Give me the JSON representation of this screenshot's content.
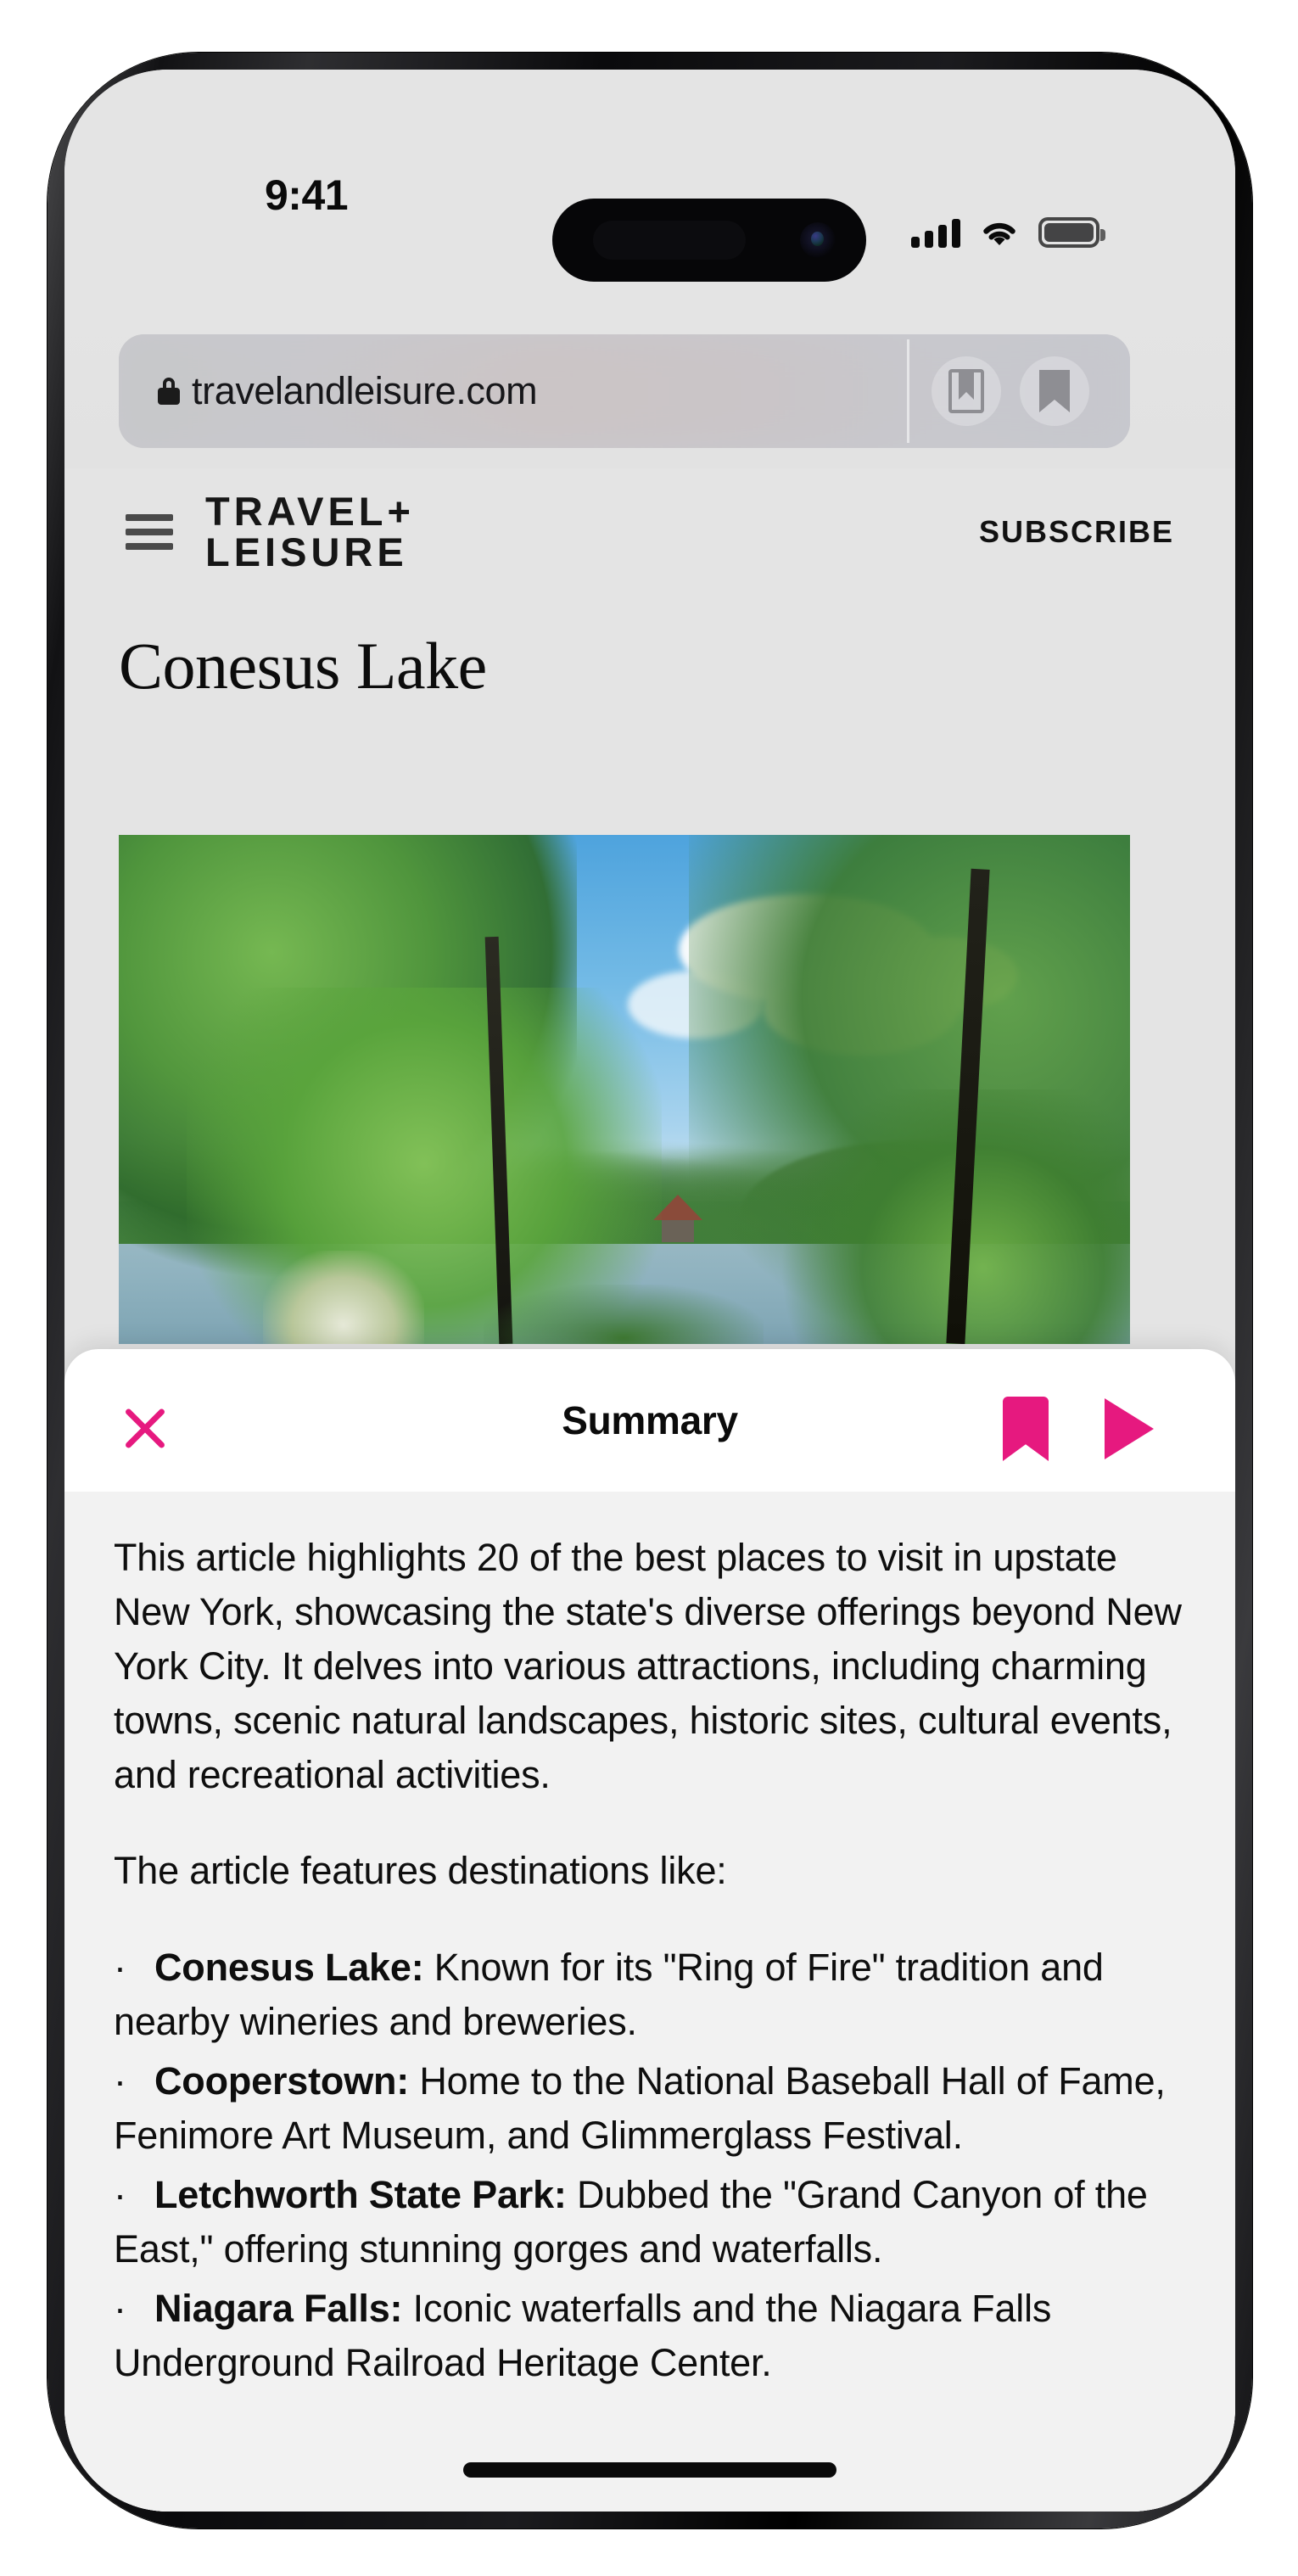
{
  "status_bar": {
    "time": "9:41",
    "cellular_icon": "cellular-signal-icon",
    "wifi_icon": "wifi-icon",
    "battery_icon": "battery-icon"
  },
  "browser": {
    "url": "travelandleisure.com",
    "lock_icon": "lock-icon",
    "reader_icon": "reader-view-icon",
    "bookmarks_icon": "bookmarks-icon"
  },
  "site_header": {
    "menu_icon": "hamburger-menu-icon",
    "brand_line1": "TRAVEL+",
    "brand_line2": "LEISURE",
    "subscribe_label": "SUBSCRIBE"
  },
  "article": {
    "headline": "Conesus Lake",
    "hero_image_alt": "Conesus Lake seen through green trees with a gazebo on the far shore"
  },
  "summary_sheet": {
    "title": "Summary",
    "close_icon": "close-x-icon",
    "bookmark_icon": "bookmark-icon",
    "play_icon": "play-icon",
    "accent_color": "#e6197f",
    "paragraph_1": "This article highlights 20 of the best places to visit in upstate New York, showcasing the state's diverse offerings beyond New York City. It delves into various attractions, including charming towns, scenic natural landscapes, historic sites, cultural events, and recreational activities.",
    "paragraph_2": "The article features destinations like:",
    "bullet_marker": "·",
    "bullets": [
      {
        "term": "Conesus Lake:",
        "text": " Known for its \"Ring of Fire\" tradition and nearby wineries and breweries."
      },
      {
        "term": "Cooperstown:",
        "text": " Home to the National Baseball Hall of Fame, Fenimore Art Museum, and Glimmerglass Festival."
      },
      {
        "term": "Letchworth State Park:",
        "text": " Dubbed the \"Grand Canyon of the East,\" offering stunning gorges and waterfalls."
      },
      {
        "term": "Niagara Falls:",
        "text": "  Iconic waterfalls and the Niagara Falls Underground Railroad Heritage Center."
      }
    ]
  },
  "device": {
    "home_indicator": "home-indicator"
  }
}
